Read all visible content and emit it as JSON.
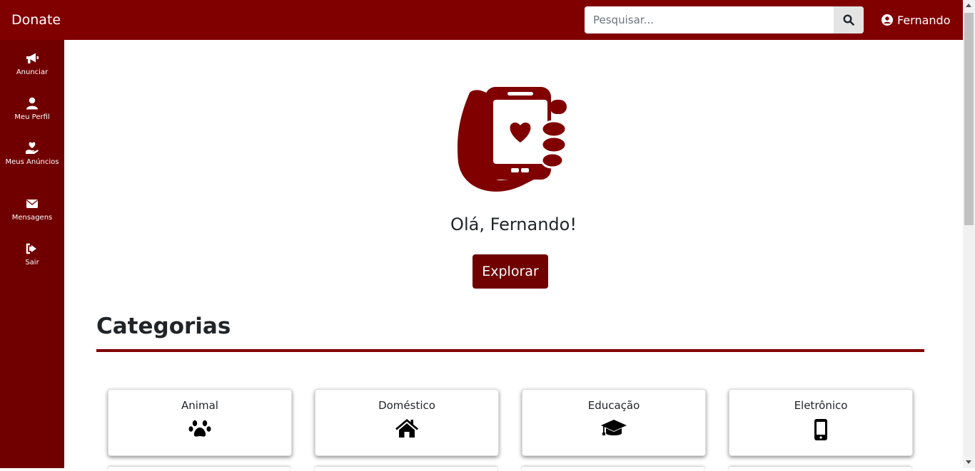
{
  "header": {
    "brand": "Donate",
    "search": {
      "placeholder": "Pesquisar...",
      "value": ""
    },
    "user_name": "Fernando"
  },
  "sidebar": {
    "items": [
      {
        "label": "Anunciar",
        "icon": "megaphone-icon"
      },
      {
        "label": "Meu Perfil",
        "icon": "user-icon"
      },
      {
        "label": "Meus Anúncios",
        "icon": "hand-holding-heart-icon"
      },
      {
        "label": "Mensagens",
        "icon": "envelope-icon"
      },
      {
        "label": "Sair",
        "icon": "sign-out-icon"
      }
    ]
  },
  "main": {
    "greeting": "Olá, Fernando!",
    "explore_label": "Explorar",
    "categories_title": "Categorias",
    "categories": [
      {
        "label": "Animal",
        "icon": "paw-icon"
      },
      {
        "label": "Doméstico",
        "icon": "home-icon"
      },
      {
        "label": "Educação",
        "icon": "graduation-cap-icon"
      },
      {
        "label": "Eletrônico",
        "icon": "mobile-phone-icon"
      }
    ]
  },
  "colors": {
    "primary": "#800000",
    "sidebar": "#700000",
    "button": "#700000"
  }
}
